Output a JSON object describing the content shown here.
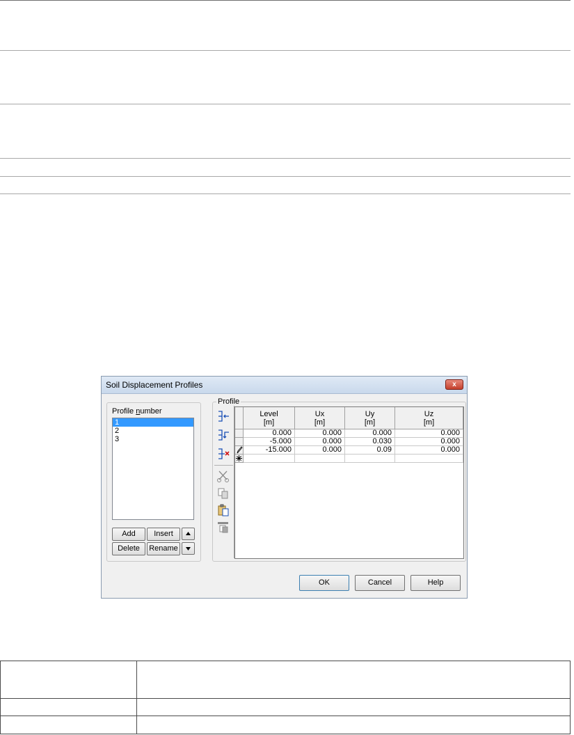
{
  "dialog": {
    "title": "Soil Displacement Profiles",
    "close_glyph": "x"
  },
  "profile_number": {
    "label": "Profile number",
    "items": [
      "1",
      "2",
      "3"
    ],
    "selected": "1"
  },
  "buttons": {
    "add": "Add",
    "insert": "Insert",
    "delete": "Delete",
    "rename": "Rename",
    "ok": "OK",
    "cancel": "Cancel",
    "help": "Help"
  },
  "profile": {
    "group_label": "Profile",
    "toolbar_icons": [
      "insert-row-icon",
      "append-row-icon",
      "delete-row-icon",
      "cut-icon",
      "copy-icon",
      "paste-icon",
      "paste-special-icon"
    ],
    "columns": [
      {
        "name": "Level",
        "unit": "[m]"
      },
      {
        "name": "Ux",
        "unit": "[m]"
      },
      {
        "name": "Uy",
        "unit": "[m]"
      },
      {
        "name": "Uz",
        "unit": "[m]"
      }
    ],
    "rows": [
      {
        "marker": "",
        "level": "0.000",
        "ux": "0.000",
        "uy": "0.000",
        "uz": "0.000"
      },
      {
        "marker": "",
        "level": "-5.000",
        "ux": "0.000",
        "uy": "0.030",
        "uz": "0.000"
      },
      {
        "marker": "pencil-icon",
        "level": "-15.000",
        "ux": "0.000",
        "uy": "0.09",
        "uz": "0.000"
      },
      {
        "marker": "new-row-asterisk-icon",
        "level": "",
        "ux": "",
        "uy": "",
        "uz": ""
      }
    ]
  }
}
